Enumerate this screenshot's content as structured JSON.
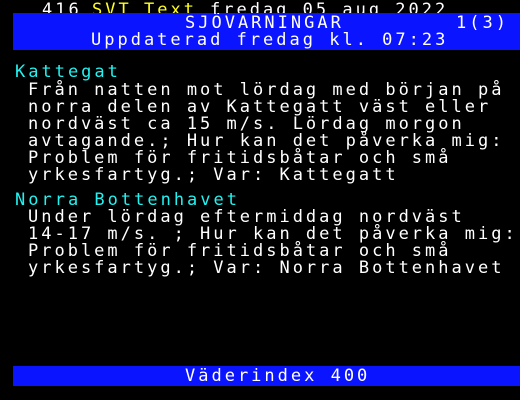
{
  "header": {
    "page_number": "416",
    "channel_svt": "SVT",
    "channel_text": "Text",
    "date": "fredag 05 aug 2022"
  },
  "title_bar": {
    "title": "SJÖVARNINGAR",
    "subpage": "1(3)",
    "updated": "Uppdaterad fredag kl. 07:23"
  },
  "warnings": [
    {
      "region": "Kattegat",
      "lines": [
        "Från natten mot lördag med början på",
        "norra delen av Kattegatt väst eller",
        "nordväst ca 15 m/s. Lördag morgon",
        "avtagande.; Hur kan det påverka mig:",
        "Problem för fritidsbåtar och små",
        "yrkesfartyg.; Var: Kattegatt"
      ]
    },
    {
      "region": "Norra Bottenhavet",
      "lines": [
        "Under lördag eftermiddag nordväst",
        "14-17 m/s. ; Hur kan det påverka mig:",
        "Problem för fritidsbåtar och små",
        "yrkesfartyg.; Var: Norra Bottenhavet"
      ]
    }
  ],
  "footer": {
    "link_label": "Väderindex 400"
  },
  "colors": {
    "background": "#000000",
    "bar": "#0a14ff",
    "heading": "#22f2f0",
    "brand": "#ffff22",
    "text": "#ffffff"
  }
}
